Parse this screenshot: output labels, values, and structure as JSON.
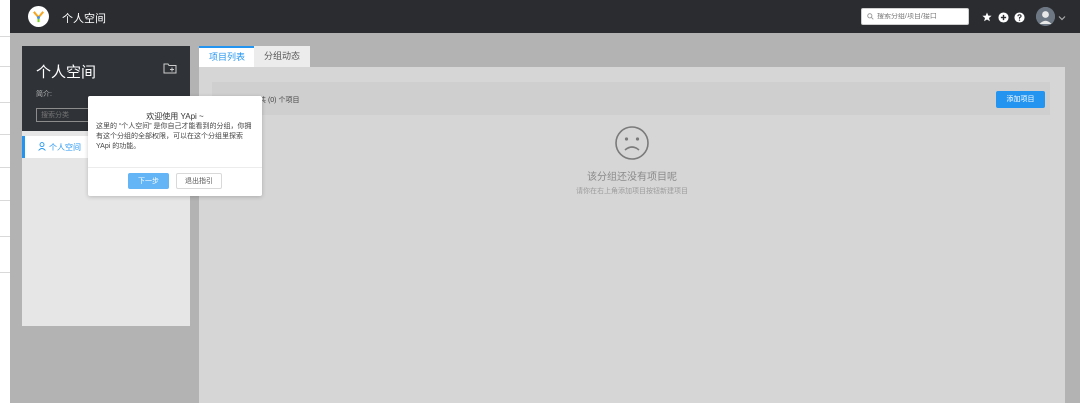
{
  "header": {
    "breadcrumb": "个人空间",
    "search_placeholder": "搜索分组/项目/接口"
  },
  "sidebar": {
    "title": "个人空间",
    "intro_label": "简介:",
    "category_search_placeholder": "搜索分类",
    "group_item_label": "个人空间"
  },
  "tabs": [
    {
      "label": "项目列表",
      "active": true
    },
    {
      "label": "分组动态",
      "active": false
    }
  ],
  "project_list": {
    "count_label": "共 (0) 个项目",
    "add_button": "添加项目",
    "empty_title": "该分组还没有项目呢",
    "empty_subtitle": "请你在右上角添加项目按钮新建项目"
  },
  "tour": {
    "title": "欢迎使用 YApi ~",
    "text": "这里的 “个人空间” 是你自己才能看到的分组，你拥有这个分组的全部权限，可以在这个分组里探索 YApi 的功能。",
    "next_button": "下一步",
    "exit_button": "退出指引"
  },
  "colors": {
    "header_bg": "#2a2c30",
    "accent": "#2395f1",
    "overlay": "#b3b3b3"
  }
}
